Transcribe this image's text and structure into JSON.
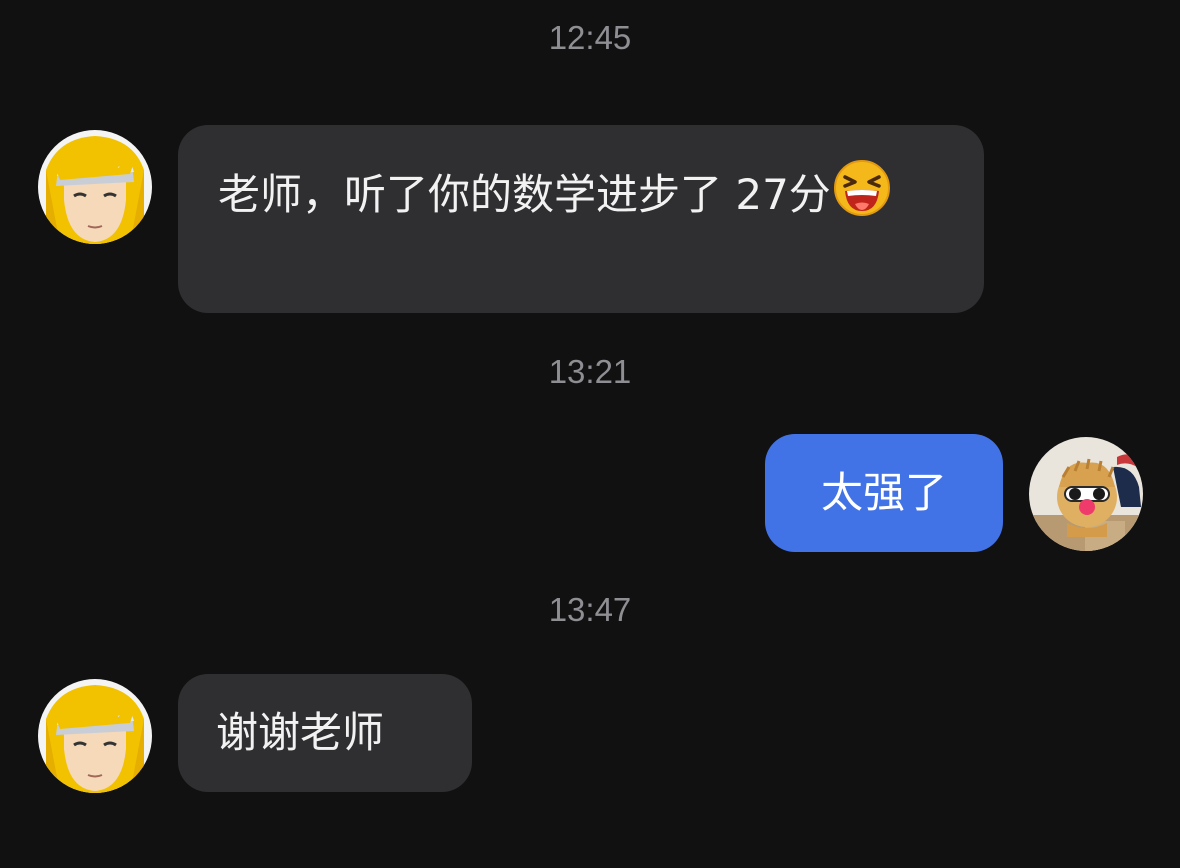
{
  "chat": {
    "messages": [
      {
        "kind": "timestamp",
        "text": "12:45"
      },
      {
        "kind": "received",
        "text": "老师，听了你的数学进步了 27分",
        "emoji": "laughing-squinting-face-emoji"
      },
      {
        "kind": "timestamp",
        "text": "13:21"
      },
      {
        "kind": "sent",
        "text": "太强了"
      },
      {
        "kind": "timestamp",
        "text": "13:47"
      },
      {
        "kind": "received",
        "text": "谢谢老师"
      }
    ]
  },
  "avatars": {
    "contact": "anime-character-avatar",
    "self": "pink-toy-sunglasses-avatar"
  },
  "colors": {
    "background": "#111112",
    "incoming_bubble": "#2f2f31",
    "outgoing_bubble": "#4273e6",
    "timestamp": "#8e8e93"
  }
}
